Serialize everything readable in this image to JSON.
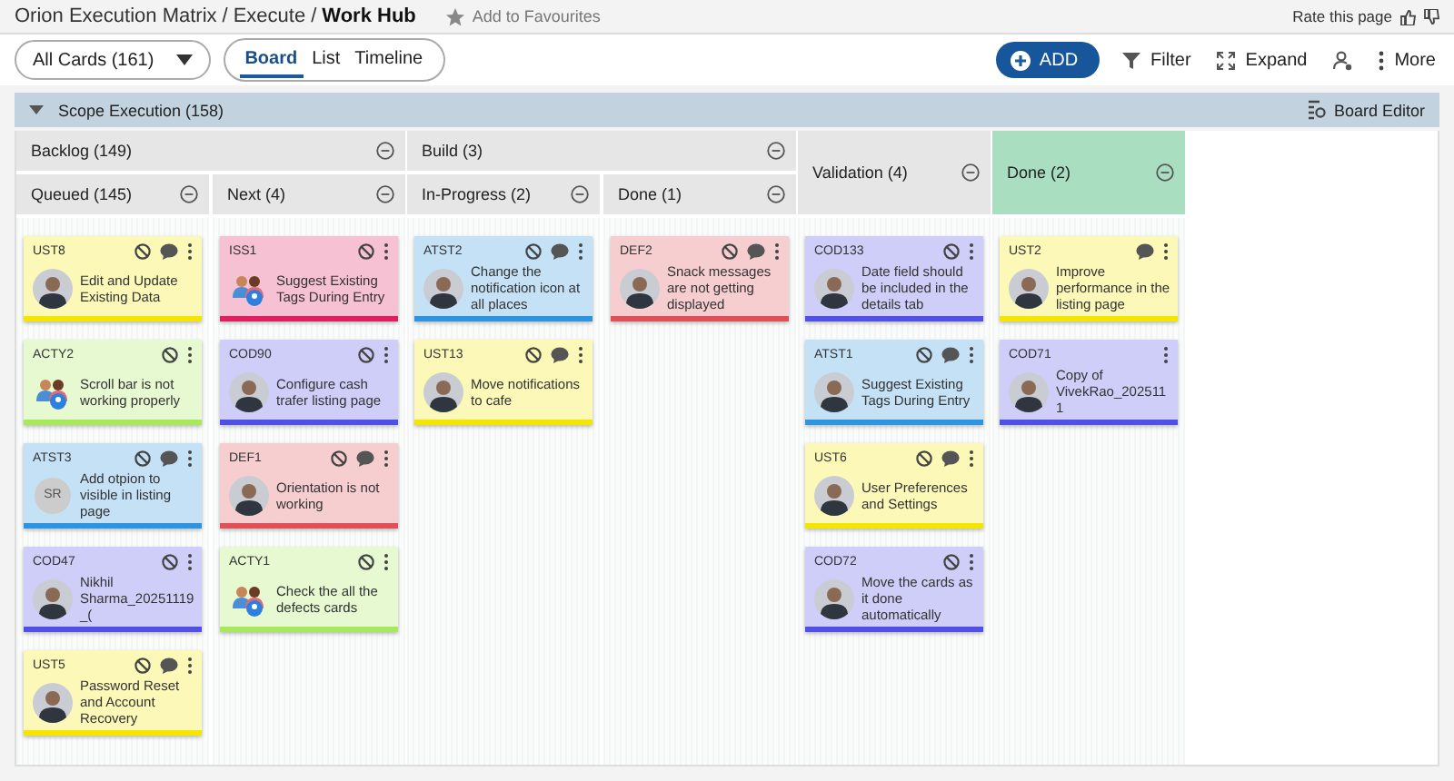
{
  "breadcrumb": [
    {
      "label": "Orion Execution Matrix",
      "current": false
    },
    {
      "separator": "/",
      "label": "Execute",
      "current": false
    },
    {
      "separator": "/",
      "label": "Work Hub",
      "current": true
    }
  ],
  "favourite": "Add to Favourites",
  "rate": "Rate this page",
  "filter_dropdown": "All Cards (161)",
  "view_tabs": [
    {
      "label": "Board",
      "selected": true
    },
    {
      "label": "List",
      "selected": false
    },
    {
      "label": "Timeline",
      "selected": false
    }
  ],
  "actions": [
    {
      "kind": "add",
      "label": "ADD"
    },
    {
      "kind": "filter",
      "label": "Filter"
    },
    {
      "kind": "expand",
      "label": "Expand"
    },
    {
      "kind": "assign"
    },
    {
      "kind": "more",
      "label": "More"
    }
  ],
  "section": {
    "title": "Scope Execution (158)",
    "expanded": true,
    "editor": "Board Editor"
  },
  "lanes": [
    {
      "kind": "group",
      "title": "Backlog (149)",
      "columns": [
        {
          "title": "Queued (145)",
          "cards": [
            {
              "id": "UST8",
              "color": "#f5e600",
              "title": "Edit and Update Existing Data",
              "blocked": true,
              "comment": true
            },
            {
              "id": "ACTY2",
              "color": "#a6ea5c",
              "title": "Scroll bar is not working properly",
              "avatar": {
                "kind": "team"
              },
              "blocked": true,
              "comment": false
            },
            {
              "id": "ATST3",
              "color": "#2d95e0",
              "title": "Add otpion to visible in listing page",
              "avatar": {
                "kind": "initials",
                "initials": "SR"
              },
              "blocked": true,
              "comment": true
            },
            {
              "id": "COD47",
              "color": "#5050e6",
              "title": "Nikhil Sharma_20251119_(",
              "blocked": true,
              "comment": false
            },
            {
              "id": "UST5",
              "color": "#f5e600",
              "title": "Password Reset and Account Recovery",
              "blocked": true,
              "comment": true
            }
          ]
        },
        {
          "title": "Next (4)",
          "cards": [
            {
              "id": "ISS1",
              "color": "#e0205e",
              "title": "Suggest Existing Tags During Entry",
              "avatar": {
                "kind": "team"
              },
              "blocked": true,
              "comment": false
            },
            {
              "id": "COD90",
              "color": "#5050e6",
              "title": "Configure cash trafer listing page",
              "blocked": true,
              "comment": false
            },
            {
              "id": "DEF1",
              "color": "#e05058",
              "title": "Orientation is not working",
              "blocked": true,
              "comment": true
            },
            {
              "id": "ACTY1",
              "color": "#a6ea5c",
              "title": "Check the all the defects cards",
              "avatar": {
                "kind": "team"
              },
              "blocked": true,
              "comment": false
            }
          ]
        }
      ]
    },
    {
      "kind": "group",
      "title": "Build (3)",
      "columns": [
        {
          "title": "In-Progress (2)",
          "cards": [
            {
              "id": "ATST2",
              "color": "#2d95e0",
              "title": "Change the notification icon at all places",
              "blocked": true,
              "comment": true
            },
            {
              "id": "UST13",
              "color": "#f5e600",
              "title": "Move notifications to cafe",
              "blocked": true,
              "comment": true
            }
          ]
        },
        {
          "title": "Done (1)",
          "cards": [
            {
              "id": "DEF2",
              "color": "#e05058",
              "title": "Snack messages are not getting displayed",
              "blocked": true,
              "comment": true
            }
          ]
        }
      ]
    },
    {
      "kind": "column",
      "title": "Validation (4)",
      "cards": [
        {
          "id": "COD133",
          "color": "#5050e6",
          "title": "Date field should be included in the details tab",
          "blocked": true,
          "comment": false
        },
        {
          "id": "ATST1",
          "color": "#2d95e0",
          "title": "Suggest Existing Tags During Entry",
          "blocked": true,
          "comment": true
        },
        {
          "id": "UST6",
          "color": "#f5e600",
          "title": "User Preferences and Settings",
          "blocked": true,
          "comment": true
        },
        {
          "id": "COD72",
          "color": "#5050e6",
          "title": "Move the cards as it done automatically",
          "blocked": true,
          "comment": false
        }
      ]
    },
    {
      "kind": "column",
      "title": "Done (2)",
      "color": "#a9dfc0",
      "cards": [
        {
          "id": "UST2",
          "color": "#f5e600",
          "title": "Improve performance in the listing page",
          "blocked": false,
          "comment": true
        },
        {
          "id": "COD71",
          "color": "#5050e6",
          "title": "Copy of VivekRao_2025111",
          "blocked": false,
          "comment": false
        }
      ]
    }
  ]
}
